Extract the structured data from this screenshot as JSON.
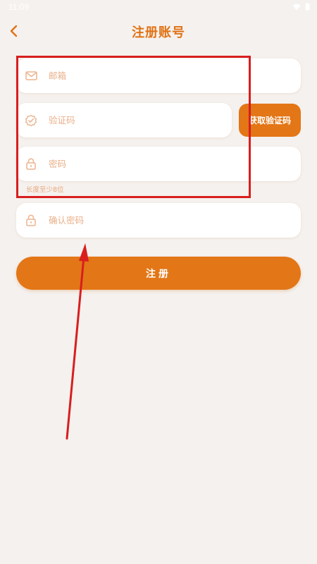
{
  "status_bar": {
    "time": "11:09"
  },
  "header": {
    "title": "注册账号"
  },
  "form": {
    "email_placeholder": "邮箱",
    "code_placeholder": "验证码",
    "get_code_label": "获取验证码",
    "password_placeholder": "密码",
    "password_hint": "长度至少8位",
    "confirm_password_placeholder": "确认密码",
    "register_label": "注册"
  },
  "colors": {
    "accent": "#e37616",
    "title": "#e07214",
    "background": "#f5f1ee",
    "placeholder": "#eab08a",
    "annotation": "#d81e1e"
  },
  "icons": {
    "back": "chevron-left-icon",
    "email": "mail-icon",
    "code": "verified-badge-icon",
    "password": "lock-icon",
    "confirm": "lock-icon"
  }
}
